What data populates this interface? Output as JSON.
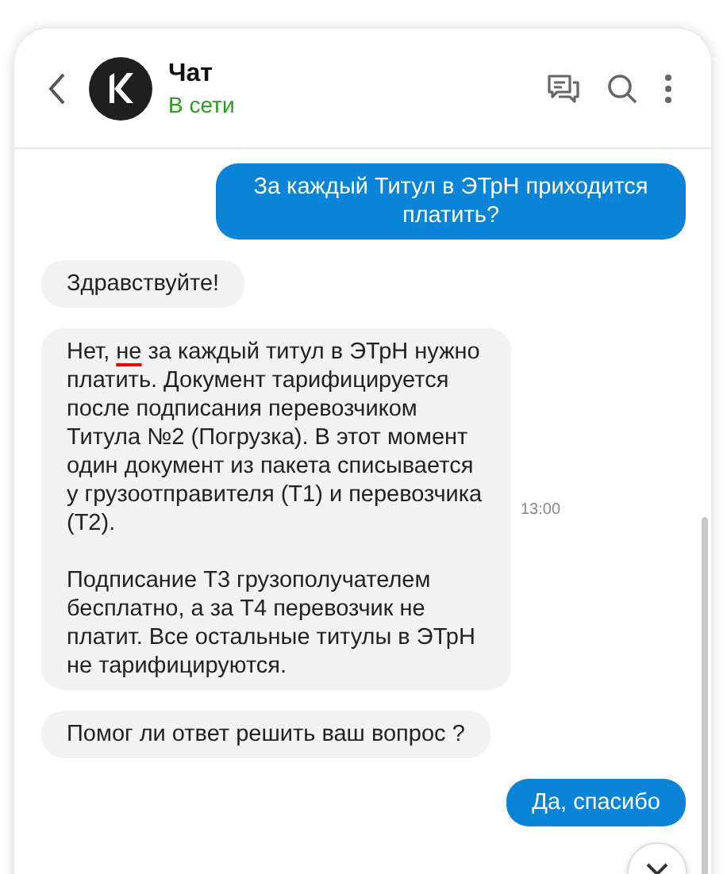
{
  "header": {
    "title": "Чат",
    "status": "В сети"
  },
  "messages": [
    {
      "kind": "outgoing",
      "paragraphs": [
        [
          {
            "text": "За каждый Титул в ЭТрН приходится платить?",
            "underline": false
          }
        ]
      ]
    },
    {
      "kind": "incoming",
      "paragraphs": [
        [
          {
            "text": "Здравствуйте!",
            "underline": false
          }
        ]
      ]
    },
    {
      "kind": "incoming",
      "time": "13:00",
      "paragraphs": [
        [
          {
            "text": "Нет, ",
            "underline": false
          },
          {
            "text": "не",
            "underline": true
          },
          {
            "text": " за каждый титул в ЭТрН нужно платить. Документ тарифицируется после подписания перевозчиком Титула №2 (Погрузка). В этот момент один документ из пакета списывается у грузоотправителя (Т1) и перевозчика (Т2).",
            "underline": false
          }
        ],
        [
          {
            "text": "Подписание Т3 грузополучателем бесплатно, а за Т4 перевозчик не платит. Все остальные титулы в ЭТрН не тарифицируются.",
            "underline": false
          }
        ]
      ]
    },
    {
      "kind": "incoming",
      "paragraphs": [
        [
          {
            "text": "Помог ли ответ решить ваш вопрос ?",
            "underline": false
          }
        ]
      ]
    },
    {
      "kind": "outgoing",
      "paragraphs": [
        [
          {
            "text": "Да, спасибо",
            "underline": false
          }
        ]
      ]
    }
  ]
}
